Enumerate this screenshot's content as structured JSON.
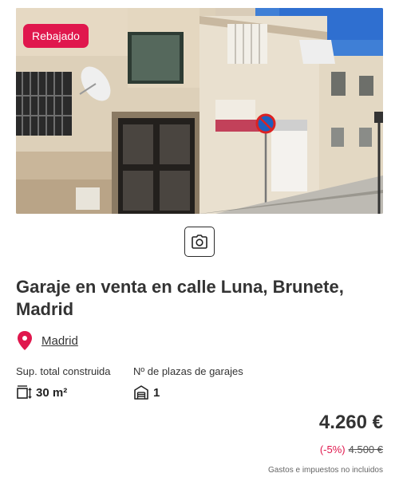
{
  "listing": {
    "badge": "Rebajado",
    "title": "Garaje en venta en calle Luna, Brunete, Madrid",
    "location": "Madrid",
    "features": [
      {
        "label": "Sup. total construida",
        "value": "30 m²",
        "icon": "area-icon"
      },
      {
        "label": "Nº de plazas de garajes",
        "value": "1",
        "icon": "garage-icon"
      }
    ],
    "price": "4.260 €",
    "discount": "(-5%)",
    "old_price": "4.500 €",
    "tax_note": "Gastos e impuestos no incluidos"
  },
  "photo": {
    "subject": "building-facade-photo"
  },
  "icons": {
    "camera": "camera-icon",
    "location": "location-pin-icon"
  },
  "colors": {
    "accent": "#e0174d",
    "text": "#333333"
  }
}
